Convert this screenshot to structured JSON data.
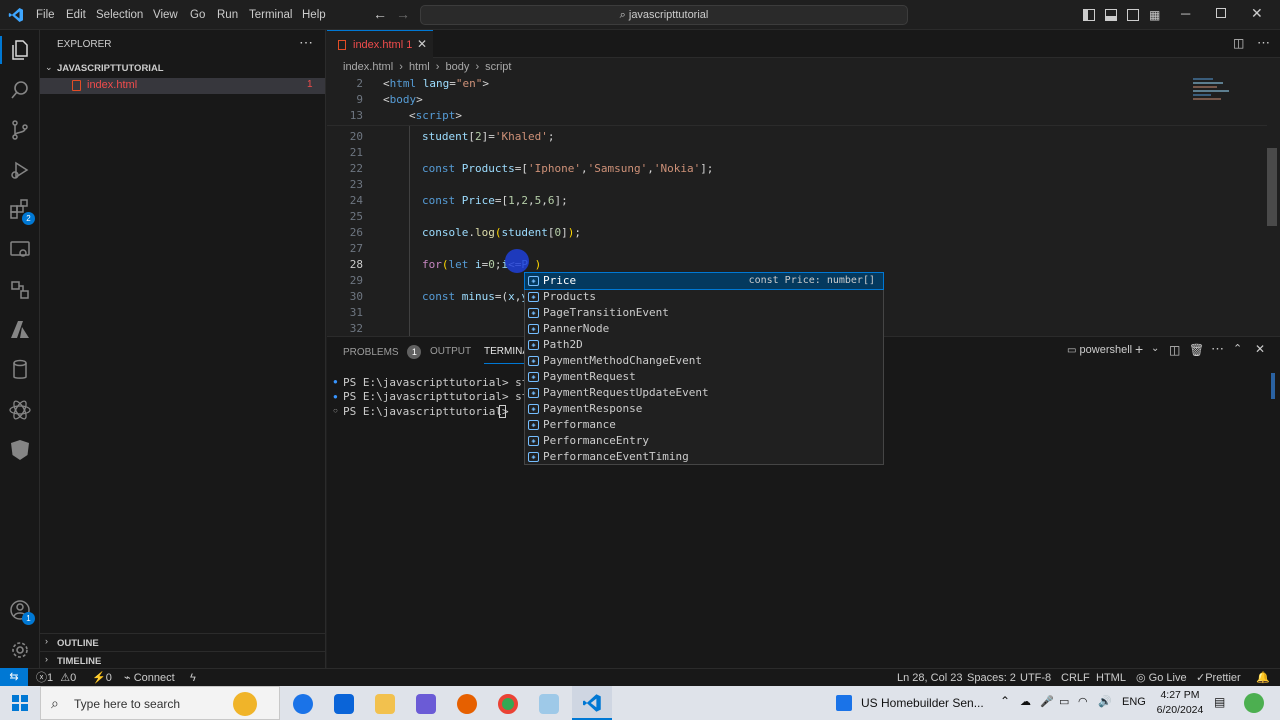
{
  "titlebar": {
    "menus": [
      "File",
      "Edit",
      "Selection",
      "View",
      "Go",
      "Run",
      "Terminal",
      "Help"
    ],
    "search": "javascripttutorial"
  },
  "sidebar": {
    "title": "EXPLORER",
    "folder": "JAVASCRIPTTUTORIAL",
    "file": "index.html",
    "file_badge": "1",
    "outline": "OUTLINE",
    "timeline": "TIMELINE"
  },
  "activity": {
    "badge_ext": "2",
    "badge_account": "1"
  },
  "editor": {
    "tab": "index.html 1",
    "breadcrumb": [
      "index.html",
      "html",
      "body",
      "script"
    ],
    "lines": [
      "2",
      "9",
      "13",
      "20",
      "21",
      "22",
      "23",
      "24",
      "25",
      "26",
      "27",
      "28",
      "29",
      "30",
      "31",
      "32"
    ]
  },
  "suggest": {
    "detail": "const Price: number[]",
    "items": [
      "Price",
      "Products",
      "PageTransitionEvent",
      "PannerNode",
      "Path2D",
      "PaymentMethodChangeEvent",
      "PaymentRequest",
      "PaymentRequestUpdateEvent",
      "PaymentResponse",
      "Performance",
      "PerformanceEntry",
      "PerformanceEventTiming"
    ]
  },
  "panel": {
    "tabs": [
      "PROBLEMS",
      "OUTPUT",
      "TERMINAL"
    ],
    "problems_count": "1",
    "shell": "powershell",
    "terminal_lines": [
      "PS E:\\javascripttutorial> star",
      "PS E:\\javascripttutorial> star",
      "PS E:\\javascripttutorial> "
    ]
  },
  "statusbar": {
    "errors": "1",
    "warnings": "0",
    "ports": "0",
    "connect": "Connect",
    "position": "Ln 28, Col 23",
    "spaces": "Spaces: 2",
    "encoding": "UTF-8",
    "eol": "CRLF",
    "language": "HTML",
    "golive": "Go Live",
    "prettier": "Prettier"
  },
  "taskbar": {
    "search_placeholder": "Type here to search",
    "news": "US Homebuilder Sen...",
    "lang": "ENG",
    "time": "4:27 PM",
    "date": "6/20/2024"
  },
  "colors": {
    "accent": "#0078d4",
    "tab_active_text": "#f14c4c"
  }
}
